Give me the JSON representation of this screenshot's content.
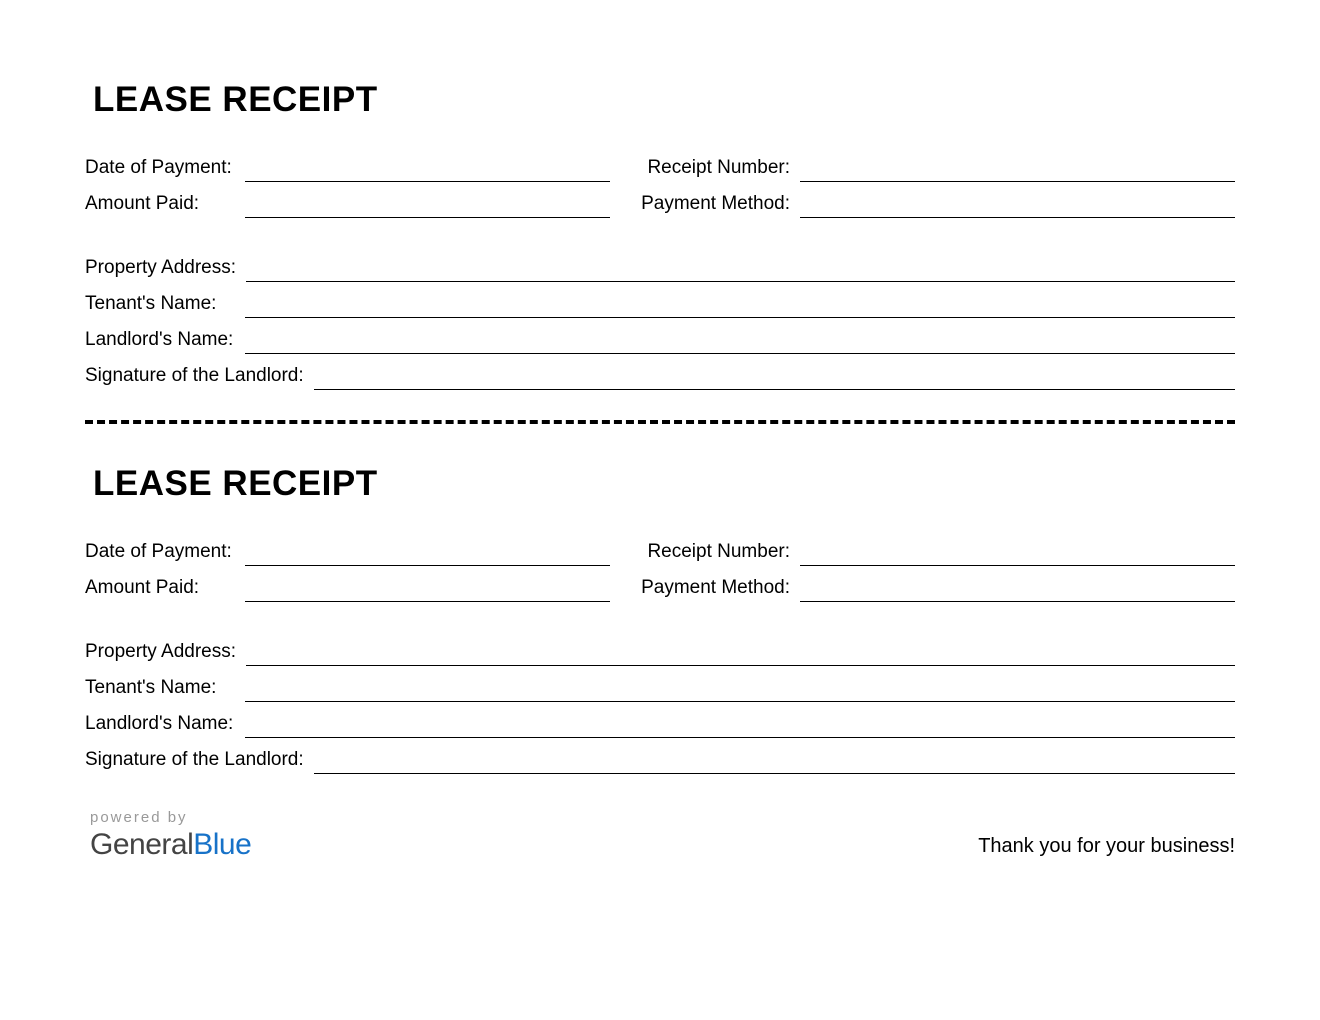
{
  "receipt": {
    "title": "LEASE RECEIPT",
    "fields": {
      "date_of_payment": "Date of Payment:",
      "receipt_number": "Receipt Number:",
      "amount_paid": "Amount Paid:",
      "payment_method": "Payment Method:",
      "property_address": "Property Address:",
      "tenants_name": "Tenant's Name:",
      "landlords_name": "Landlord's Name:",
      "signature": "Signature of the Landlord:"
    }
  },
  "footer": {
    "powered_by": "powered by",
    "logo_part1": "General",
    "logo_part2": "Blue",
    "thanks": "Thank you for your business!"
  }
}
